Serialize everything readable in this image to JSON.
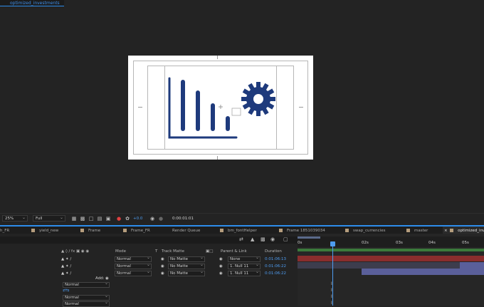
{
  "comp_tab": {
    "label": "optimized_investments"
  },
  "viewer_toolbar": {
    "zoom": "25%",
    "resolution": "Full",
    "exposure": "+0.0",
    "timecode": "0:00:01:01"
  },
  "timeline_tabs": [
    {
      "label": "h_FR"
    },
    {
      "label": "yield_new"
    },
    {
      "label": "Frame"
    },
    {
      "label": "Frame_FR"
    },
    {
      "label": "Render Queue"
    },
    {
      "label": "bm_fontHelper"
    },
    {
      "label": "Frame 1851039034"
    },
    {
      "label": "swap_currencies"
    },
    {
      "label": "master"
    },
    {
      "label": "optimized_inve"
    }
  ],
  "columns": {
    "mode": "Mode",
    "t": "T",
    "track_matte": "Track Matte",
    "parent_link": "Parent & Link",
    "duration": "Duration"
  },
  "layers": [
    {
      "mode": "Normal",
      "matte": "No Matte",
      "parent": "None",
      "duration": "0:01:06:13"
    },
    {
      "mode": "Normal",
      "matte": "No Matte",
      "parent": "1. Null 11",
      "duration": "0:01:06:22"
    },
    {
      "mode": "Normal",
      "matte": "No Matte",
      "parent": "1. Null 11",
      "duration": "0:01:06:22"
    }
  ],
  "add_label": "Add:",
  "sub_modes": [
    "Normal",
    "Normal",
    "Normal"
  ],
  "ruler": [
    "0s",
    "02s",
    "03s",
    "04s",
    "05s"
  ],
  "colors": {
    "accent": "#2d8ceb",
    "bar_green": "#3b7a3b",
    "bar_red": "#8a2d2d",
    "bar_purple": "#5a5f9a",
    "chart_navy": "#1e3a7c"
  }
}
